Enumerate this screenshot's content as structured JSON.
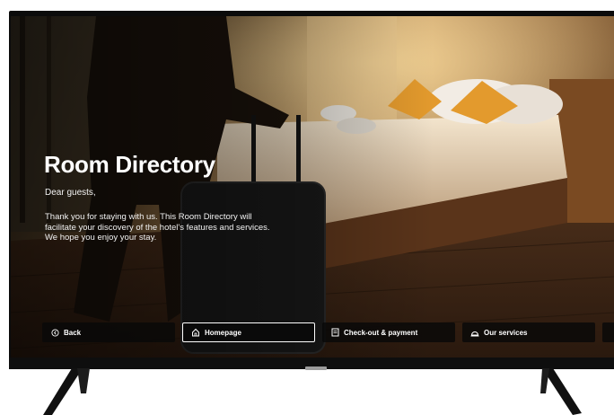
{
  "screen": {
    "title": "Room Directory",
    "greeting": "Dear guests,",
    "intro": "Thank you for staying with us. This Room Directory will facilitate your discovery of the hotel's features and services. We hope you enjoy your stay."
  },
  "nav": {
    "items": [
      {
        "label": "Back",
        "icon": "back-circle-icon",
        "active": false
      },
      {
        "label": "Homepage",
        "icon": "home-icon",
        "active": true
      },
      {
        "label": "Check-out & payment",
        "icon": "receipt-icon",
        "active": false
      },
      {
        "label": "Our services",
        "icon": "service-bell-icon",
        "active": false
      }
    ]
  },
  "colors": {
    "button_bg": "#080808",
    "text": "#ffffff",
    "accent_pillow": "#e39a2d"
  }
}
